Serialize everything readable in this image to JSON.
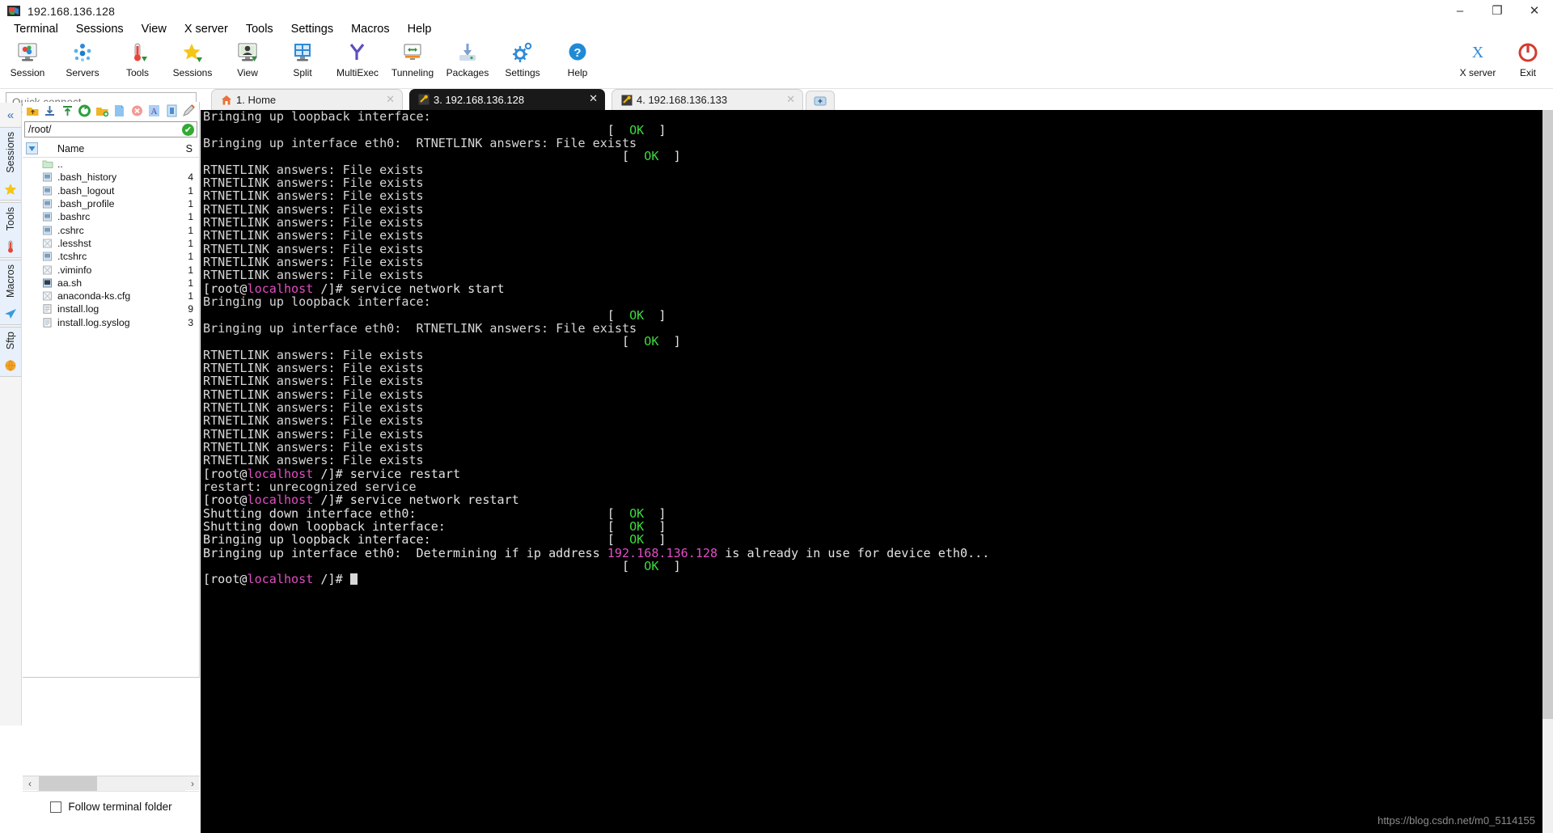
{
  "window": {
    "title": "192.168.136.128",
    "app_icon": "mobaxterm-icon",
    "minimize": "–",
    "maximize": "❐",
    "close": "✕"
  },
  "menubar": {
    "items": [
      {
        "label": "Terminal"
      },
      {
        "label": "Sessions"
      },
      {
        "label": "View"
      },
      {
        "label": "X server"
      },
      {
        "label": "Tools"
      },
      {
        "label": "Settings"
      },
      {
        "label": "Macros"
      },
      {
        "label": "Help"
      }
    ]
  },
  "toolbar": {
    "items": [
      {
        "label": "Session",
        "icon": "session-icon"
      },
      {
        "label": "Servers",
        "icon": "servers-icon"
      },
      {
        "label": "Tools",
        "icon": "tools-icon"
      },
      {
        "label": "Sessions",
        "icon": "sessions-star-icon"
      },
      {
        "label": "View",
        "icon": "view-icon"
      },
      {
        "label": "Split",
        "icon": "split-icon"
      },
      {
        "label": "MultiExec",
        "icon": "multiexec-icon"
      },
      {
        "label": "Tunneling",
        "icon": "tunneling-icon"
      },
      {
        "label": "Packages",
        "icon": "packages-icon"
      },
      {
        "label": "Settings",
        "icon": "settings-gear-icon"
      },
      {
        "label": "Help",
        "icon": "help-icon"
      }
    ],
    "right_items": [
      {
        "label": "X server",
        "icon": "x-server-icon"
      },
      {
        "label": "Exit",
        "icon": "exit-power-icon"
      }
    ]
  },
  "quick_connect": {
    "placeholder": "Quick connect..."
  },
  "rail": {
    "collapse": "«",
    "groups": [
      {
        "label": "Sessions",
        "icon": "star-icon"
      },
      {
        "label": "Tools",
        "icon": "tools-thermometer-icon"
      },
      {
        "label": "Macros",
        "icon": "macros-paperplane-icon"
      },
      {
        "label": "Sftp",
        "icon": "sftp-globe-icon"
      }
    ]
  },
  "sftp": {
    "toolbar_buttons": [
      "up-folder-icon",
      "download-icon",
      "upload-icon",
      "refresh-icon",
      "new-folder-icon",
      "new-file-icon",
      "delete-icon",
      "text-mode-icon",
      "raw-mode-icon",
      "edit-icon"
    ],
    "path": "/root/",
    "path_status": "✔",
    "columns": {
      "name": "Name",
      "size": "S"
    },
    "files": [
      {
        "name": "..",
        "size": "",
        "icon": "parent-folder-icon"
      },
      {
        "name": ".bash_history",
        "size": "4",
        "icon": "file-icon"
      },
      {
        "name": ".bash_logout",
        "size": "1",
        "icon": "file-icon"
      },
      {
        "name": ".bash_profile",
        "size": "1",
        "icon": "file-icon"
      },
      {
        "name": ".bashrc",
        "size": "1",
        "icon": "file-icon"
      },
      {
        "name": ".cshrc",
        "size": "1",
        "icon": "file-icon"
      },
      {
        "name": ".lesshst",
        "size": "1",
        "icon": "unknown-file-icon"
      },
      {
        "name": ".tcshrc",
        "size": "1",
        "icon": "file-icon"
      },
      {
        "name": ".viminfo",
        "size": "1",
        "icon": "unknown-file-icon"
      },
      {
        "name": "aa.sh",
        "size": "1",
        "icon": "script-file-icon"
      },
      {
        "name": "anaconda-ks.cfg",
        "size": "1",
        "icon": "unknown-file-icon"
      },
      {
        "name": "install.log",
        "size": "9",
        "icon": "log-file-icon"
      },
      {
        "name": "install.log.syslog",
        "size": "3",
        "icon": "log-file-icon"
      }
    ],
    "hscroll": {
      "left": "‹",
      "right": "›"
    },
    "follow_terminal_folder": "Follow terminal folder",
    "follow_checked": false
  },
  "tabs": [
    {
      "label": "1. Home",
      "icon": "home-icon",
      "active": false,
      "closable": true
    },
    {
      "label": "3. 192.168.136.128",
      "icon": "ssh-key-icon",
      "active": true,
      "closable": true
    },
    {
      "label": "4. 192.168.136.133",
      "icon": "ssh-key-icon",
      "active": false,
      "closable": true
    }
  ],
  "tab_new_icon": "new-tab-icon",
  "terminal": {
    "colors": {
      "bg": "#000000",
      "fg": "#d6d6d6",
      "magenta": "#e24ec4",
      "green": "#3ddb3d"
    },
    "prompt_user": "[root@",
    "prompt_host": "localhost",
    "prompt_tail": " /]# ",
    "lines": [
      {
        "type": "prompt",
        "cmd": "service network start"
      },
      {
        "type": "plain",
        "text": "Bringing up loopback interface:"
      },
      {
        "type": "status",
        "text": "",
        "pad": 55,
        "status": "OK"
      },
      {
        "type": "plain",
        "text": "Bringing up interface eth0:  RTNETLINK answers: File exists"
      },
      {
        "type": "status",
        "text": "",
        "pad": 57,
        "status": "OK"
      },
      {
        "type": "plain",
        "text": ""
      },
      {
        "type": "plain",
        "text": "RTNETLINK answers: File exists"
      },
      {
        "type": "plain",
        "text": "RTNETLINK answers: File exists"
      },
      {
        "type": "plain",
        "text": "RTNETLINK answers: File exists"
      },
      {
        "type": "plain",
        "text": "RTNETLINK answers: File exists"
      },
      {
        "type": "plain",
        "text": "RTNETLINK answers: File exists"
      },
      {
        "type": "plain",
        "text": "RTNETLINK answers: File exists"
      },
      {
        "type": "plain",
        "text": "RTNETLINK answers: File exists"
      },
      {
        "type": "plain",
        "text": "RTNETLINK answers: File exists"
      },
      {
        "type": "plain",
        "text": "RTNETLINK answers: File exists"
      },
      {
        "type": "prompt",
        "cmd": "service network start"
      },
      {
        "type": "plain",
        "text": "Bringing up loopback interface:"
      },
      {
        "type": "status",
        "text": "",
        "pad": 55,
        "status": "OK"
      },
      {
        "type": "plain",
        "text": "Bringing up interface eth0:  RTNETLINK answers: File exists"
      },
      {
        "type": "status",
        "text": "",
        "pad": 57,
        "status": "OK"
      },
      {
        "type": "plain",
        "text": ""
      },
      {
        "type": "plain",
        "text": "RTNETLINK answers: File exists"
      },
      {
        "type": "plain",
        "text": "RTNETLINK answers: File exists"
      },
      {
        "type": "plain",
        "text": "RTNETLINK answers: File exists"
      },
      {
        "type": "plain",
        "text": "RTNETLINK answers: File exists"
      },
      {
        "type": "plain",
        "text": "RTNETLINK answers: File exists"
      },
      {
        "type": "plain",
        "text": "RTNETLINK answers: File exists"
      },
      {
        "type": "plain",
        "text": "RTNETLINK answers: File exists"
      },
      {
        "type": "plain",
        "text": "RTNETLINK answers: File exists"
      },
      {
        "type": "plain",
        "text": "RTNETLINK answers: File exists"
      },
      {
        "type": "prompt",
        "cmd": "service restart"
      },
      {
        "type": "plain",
        "text": "restart: unrecognized service"
      },
      {
        "type": "prompt",
        "cmd": "service network restart"
      },
      {
        "type": "status",
        "text": "Shutting down interface eth0:",
        "pad": 55,
        "status": "OK"
      },
      {
        "type": "status",
        "text": "Shutting down loopback interface:",
        "pad": 55,
        "status": "OK"
      },
      {
        "type": "status",
        "text": "Bringing up loopback interface:",
        "pad": 55,
        "status": "OK"
      },
      {
        "type": "ipline",
        "pre": "Bringing up interface eth0:  Determining if ip address ",
        "ip": "192.168.136.128",
        "post": " is already in use for device eth0..."
      },
      {
        "type": "status",
        "text": "",
        "pad": 57,
        "status": "OK"
      },
      {
        "type": "plain",
        "text": ""
      },
      {
        "type": "cursor",
        "cmd": ""
      }
    ]
  },
  "watermark": "https://blog.csdn.net/m0_5114155"
}
